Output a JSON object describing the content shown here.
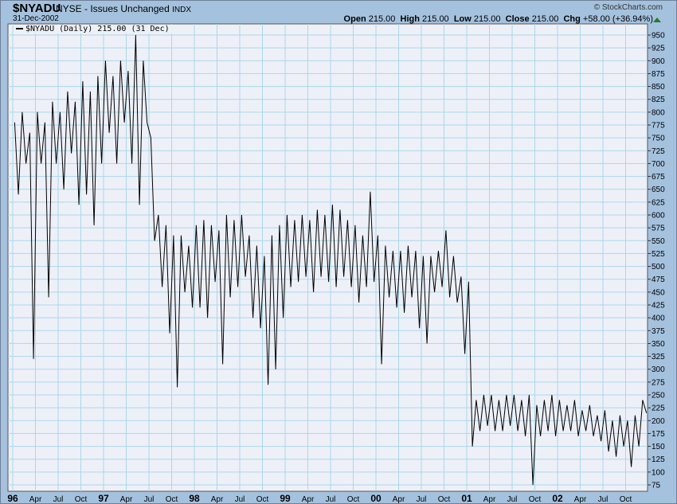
{
  "header": {
    "symbol": "$NYADU",
    "name": "NYSE - Issues Unchanged",
    "exchange": "INDX",
    "date": "31-Dec-2002",
    "credit": "© StockCharts.com",
    "open_label": "Open",
    "open": "215.00",
    "high_label": "High",
    "high": "215.00",
    "low_label": "Low",
    "low": "215.00",
    "close_label": "Close",
    "close": "215.00",
    "chg_label": "Chg",
    "chg": "+58.00 (+36.94%)"
  },
  "legend": "$NYADU (Daily) 215.00 (31 Dec)",
  "colors": {
    "background": "#a4c2de",
    "plot": "#eef0f8",
    "grid": "#a8d8ea",
    "line": "#000000",
    "up": "#2a7a2a"
  },
  "chart_data": {
    "type": "line",
    "title": "$NYADU NYSE - Issues Unchanged INDX",
    "xlabel": "",
    "ylabel": "",
    "ylim": [
      75,
      950
    ],
    "yticks": [
      75,
      100,
      125,
      150,
      175,
      200,
      225,
      250,
      275,
      300,
      325,
      350,
      375,
      400,
      425,
      450,
      475,
      500,
      525,
      550,
      575,
      600,
      625,
      650,
      675,
      700,
      725,
      750,
      775,
      800,
      825,
      850,
      875,
      900,
      925,
      950
    ],
    "xticks": [
      {
        "label": "96",
        "major": true
      },
      {
        "label": "Apr"
      },
      {
        "label": "Jul"
      },
      {
        "label": "Oct"
      },
      {
        "label": "97",
        "major": true
      },
      {
        "label": "Apr"
      },
      {
        "label": "Jul"
      },
      {
        "label": "Oct"
      },
      {
        "label": "98",
        "major": true
      },
      {
        "label": "Apr"
      },
      {
        "label": "Jul"
      },
      {
        "label": "Oct"
      },
      {
        "label": "99",
        "major": true
      },
      {
        "label": "Apr"
      },
      {
        "label": "Jul"
      },
      {
        "label": "Oct"
      },
      {
        "label": "00",
        "major": true
      },
      {
        "label": "Apr"
      },
      {
        "label": "Jul"
      },
      {
        "label": "Oct"
      },
      {
        "label": "01",
        "major": true
      },
      {
        "label": "Apr"
      },
      {
        "label": "Jul"
      },
      {
        "label": "Oct"
      },
      {
        "label": "02",
        "major": true
      },
      {
        "label": "Apr"
      },
      {
        "label": "Jul"
      },
      {
        "label": "Oct"
      }
    ],
    "x_range": [
      "1996-01",
      "2002-12"
    ],
    "series": [
      {
        "name": "$NYADU (Daily)",
        "sampling": "semi-monthly approx",
        "values": [
          780,
          640,
          800,
          700,
          760,
          320,
          800,
          700,
          780,
          440,
          820,
          700,
          800,
          650,
          840,
          720,
          820,
          620,
          860,
          640,
          840,
          580,
          870,
          700,
          900,
          760,
          870,
          700,
          900,
          780,
          880,
          700,
          950,
          620,
          900,
          780,
          750,
          550,
          600,
          460,
          580,
          370,
          560,
          265,
          560,
          450,
          540,
          420,
          580,
          420,
          590,
          400,
          580,
          470,
          570,
          310,
          600,
          440,
          590,
          460,
          600,
          480,
          560,
          400,
          540,
          380,
          520,
          270,
          560,
          300,
          580,
          400,
          600,
          460,
          590,
          470,
          600,
          480,
          590,
          450,
          610,
          480,
          600,
          470,
          620,
          460,
          610,
          480,
          590,
          460,
          580,
          430,
          560,
          460,
          645,
          470,
          560,
          310,
          540,
          440,
          530,
          420,
          530,
          410,
          540,
          440,
          530,
          380,
          520,
          350,
          520,
          450,
          530,
          460,
          570,
          440,
          520,
          430,
          480,
          330,
          470,
          150,
          240,
          180,
          250,
          190,
          250,
          180,
          240,
          180,
          250,
          190,
          250,
          180,
          240,
          170,
          250,
          75,
          230,
          170,
          240,
          180,
          250,
          170,
          240,
          180,
          230,
          180,
          240,
          170,
          220,
          180,
          230,
          170,
          210,
          160,
          220,
          140,
          200,
          130,
          210,
          150,
          200,
          110,
          210,
          150,
          240,
          215
        ]
      }
    ]
  }
}
